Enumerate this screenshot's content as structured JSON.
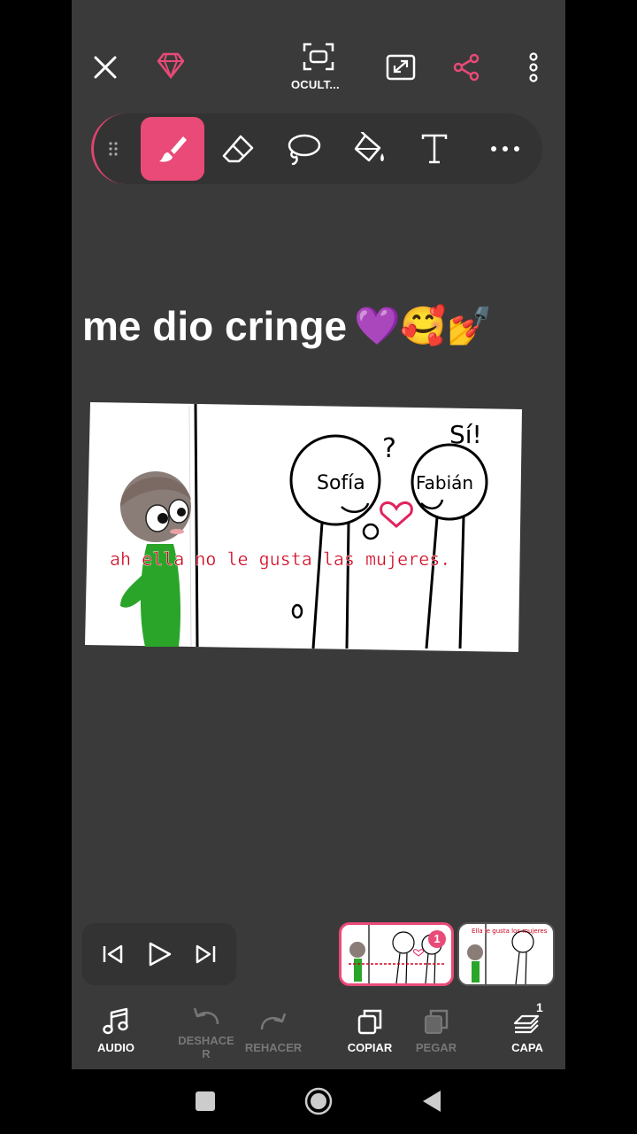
{
  "top_bar": {
    "hide_label": "OCULT..."
  },
  "caption": {
    "text": "me dio cringe",
    "emojis": "💜🥰💅"
  },
  "drawing": {
    "names": {
      "left": "Sofía",
      "right": "Fabián"
    },
    "question": "?",
    "exclaim": "Sí!",
    "subtitle": "ah ella no le gusta las mujeres."
  },
  "frames": {
    "current_badge": "1",
    "frame2_caption": "Ella le gusta los mujeres"
  },
  "bottom_bar": {
    "audio": "AUDIO",
    "undo_line1": "DESHACE",
    "undo_line2": "R",
    "redo": "REHACER",
    "copy": "COPIAR",
    "paste": "PEGAR",
    "layer": "CAPA",
    "layer_count": "1"
  },
  "colors": {
    "accent": "#e94a77",
    "panel": "#3a3a3a",
    "subtitle_red": "#d0021b",
    "heart": "#e0245e",
    "character_green": "#2aa52a"
  }
}
